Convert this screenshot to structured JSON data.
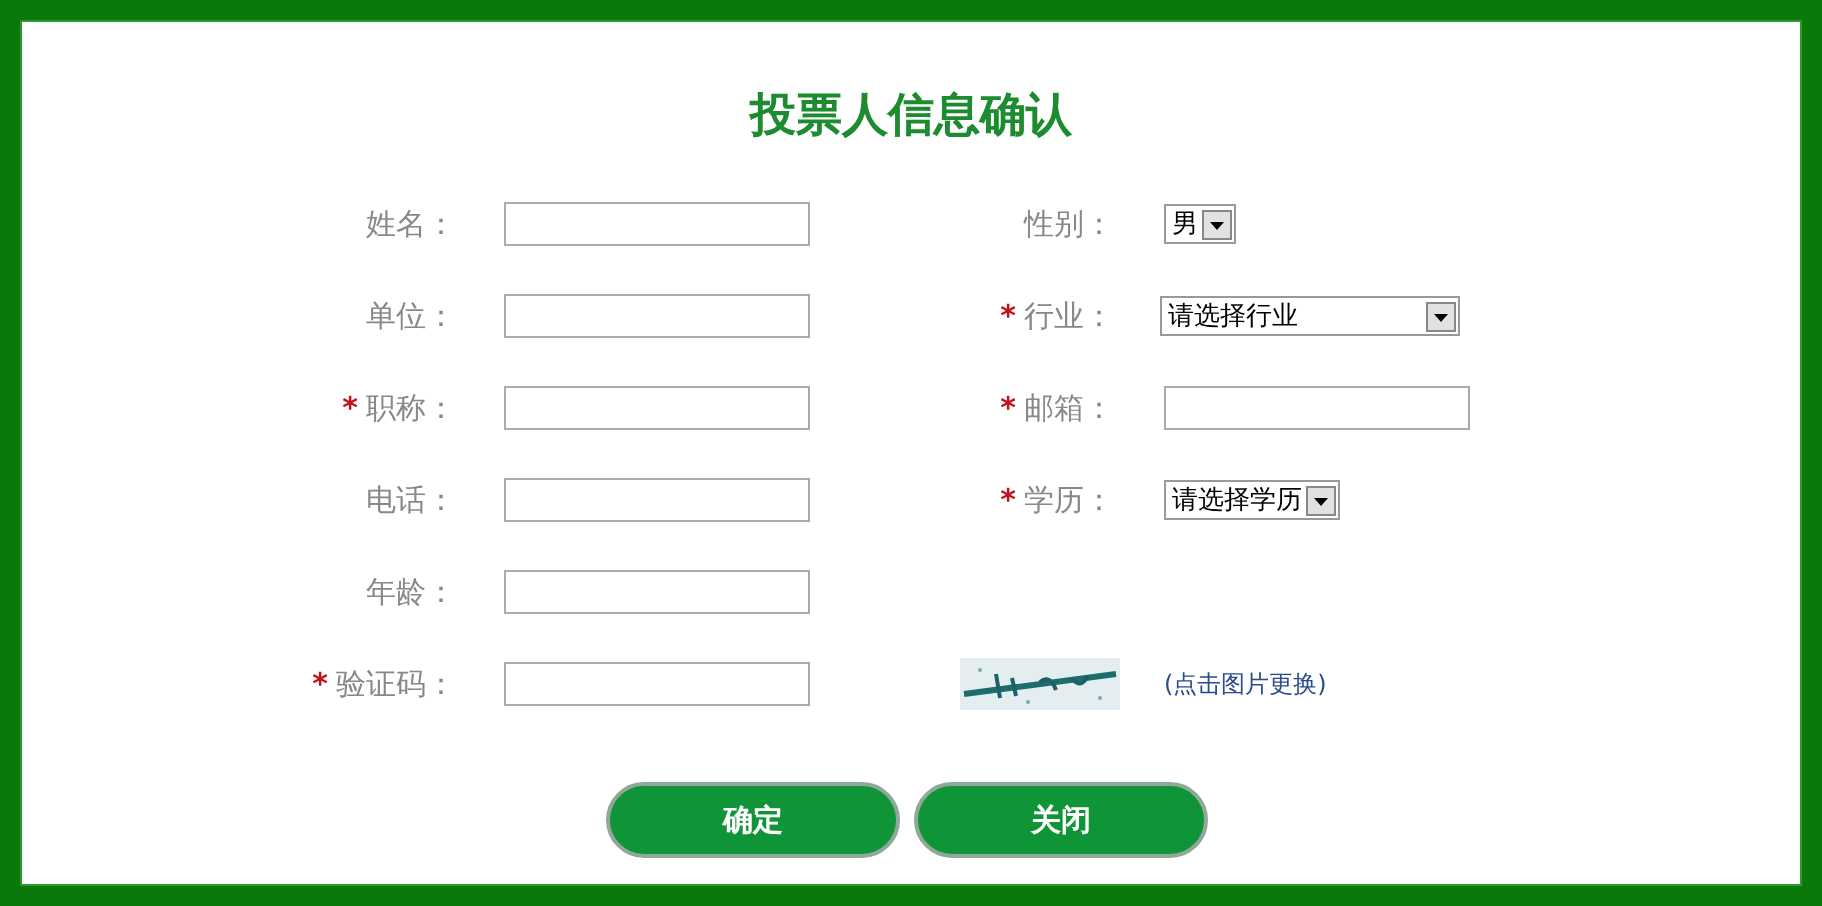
{
  "dialog": {
    "title": "投票人信息确认"
  },
  "rows": [
    {
      "fields": [
        {
          "kind": "text",
          "label": "姓名："
        },
        {
          "kind": "select",
          "label": "性别：",
          "value": "男"
        }
      ]
    },
    {
      "fields": [
        {
          "kind": "text",
          "label": "单位："
        },
        {
          "kind": "wide-select",
          "label": "行业：",
          "required_mark": "*",
          "value": "请选择行业"
        }
      ]
    },
    {
      "fields": [
        {
          "kind": "text",
          "label": "职称：",
          "required_mark": "*"
        },
        {
          "kind": "text",
          "label": "邮箱：",
          "required_mark": "*"
        }
      ]
    },
    {
      "fields": [
        {
          "kind": "text",
          "label": "电话："
        },
        {
          "kind": "select",
          "label": "学历：",
          "required_mark": "*",
          "value": "请选择学历"
        }
      ]
    },
    {
      "fields": [
        {
          "kind": "text",
          "label": "年龄："
        }
      ]
    },
    {
      "fields": [
        {
          "kind": "text",
          "label": "验证码：",
          "required_mark": "*"
        },
        {
          "kind": "captcha",
          "link": "(点击图片更换)"
        }
      ]
    }
  ],
  "buttons": [
    "确定",
    "关闭"
  ]
}
